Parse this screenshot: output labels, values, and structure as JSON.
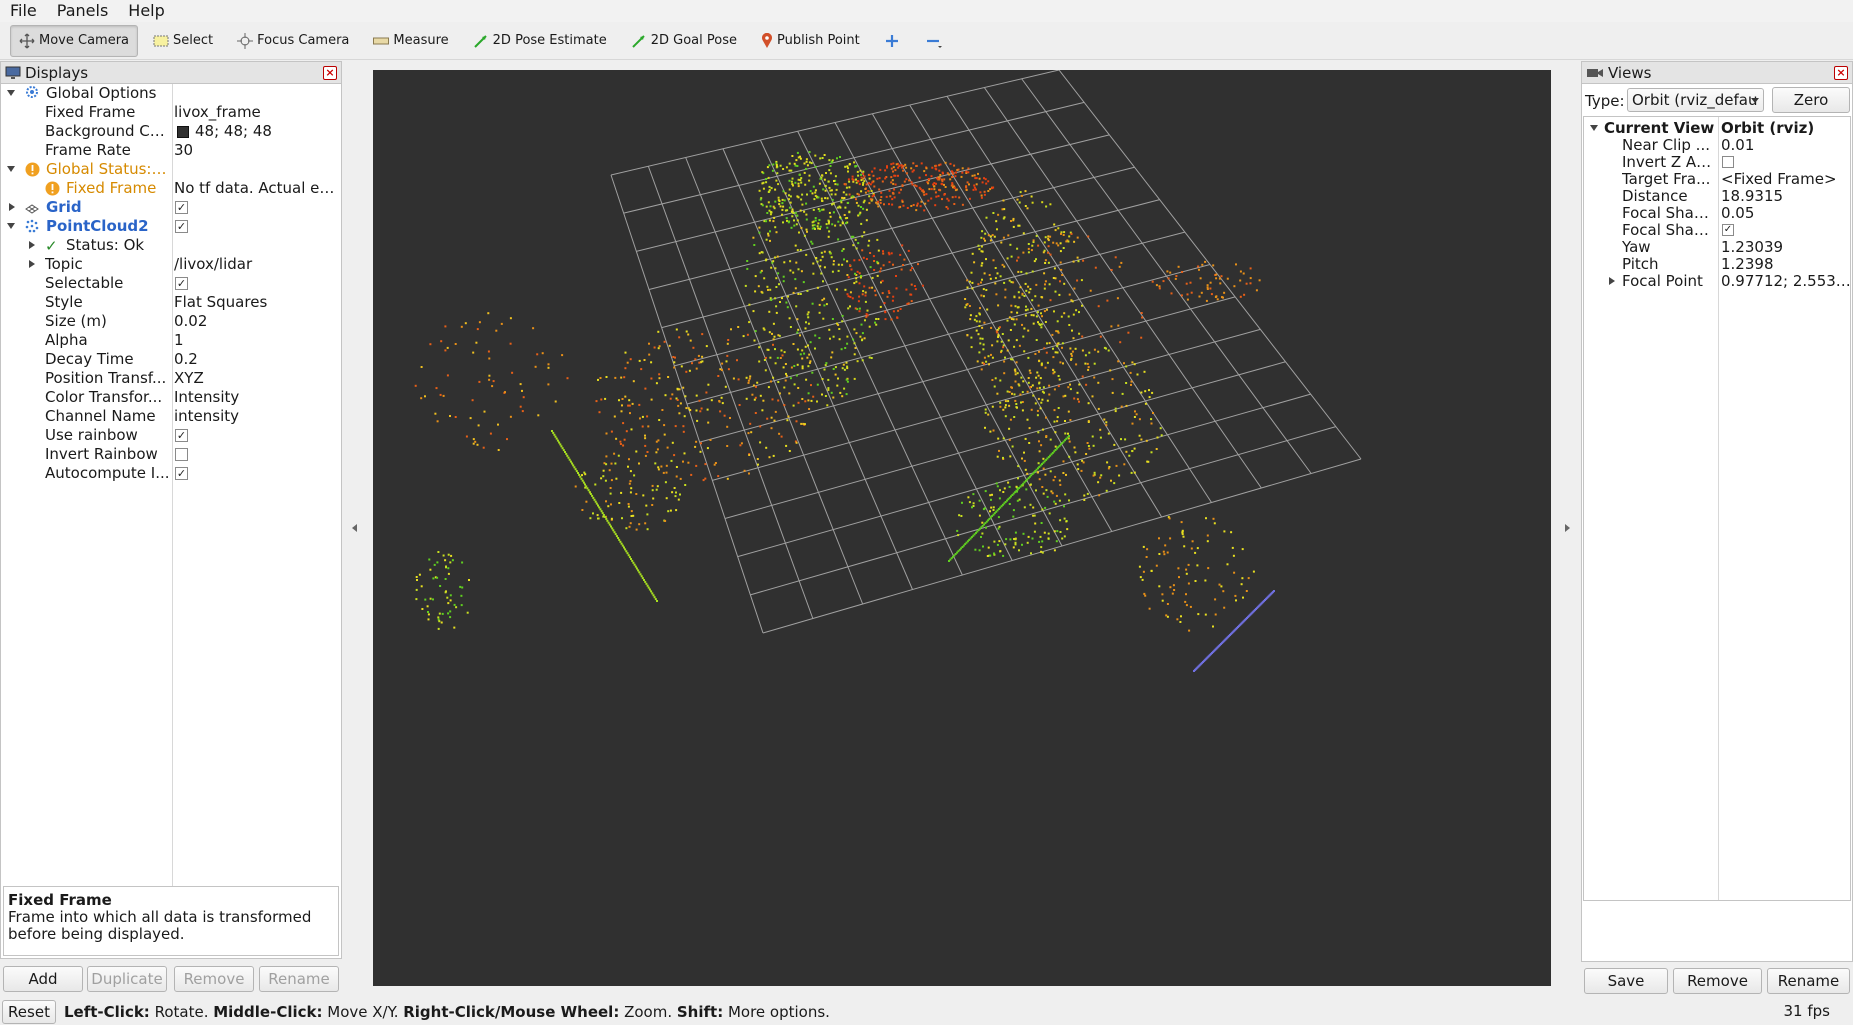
{
  "menu": [
    "File",
    "Panels",
    "Help"
  ],
  "toolbar": {
    "move_camera": "Move Camera",
    "select": "Select",
    "focus_camera": "Focus Camera",
    "measure": "Measure",
    "pose_estimate": "2D Pose Estimate",
    "goal_pose": "2D Goal Pose",
    "publish_point": "Publish Point"
  },
  "displays": {
    "title": "Displays",
    "rows": {
      "global_options": "Global Options",
      "fixed_frame_label": "Fixed Frame",
      "fixed_frame_value": "livox_frame",
      "bg_color_label": "Background Color",
      "bg_color_value": "48; 48; 48",
      "frame_rate_label": "Frame Rate",
      "frame_rate_value": "30",
      "global_status": "Global Status: ...",
      "status_fixed_frame": "Fixed Frame",
      "status_fixed_frame_value": "No tf data.  Actual err...",
      "grid": "Grid",
      "pointcloud": "PointCloud2",
      "status_ok": "Status: Ok",
      "topic_label": "Topic",
      "topic_value": "/livox/lidar",
      "selectable": "Selectable",
      "style_label": "Style",
      "style_value": "Flat Squares",
      "size_label": "Size (m)",
      "size_value": "0.02",
      "alpha_label": "Alpha",
      "alpha_value": "1",
      "decay_label": "Decay Time",
      "decay_value": "0.2",
      "pos_tf_label": "Position Transf...",
      "pos_tf_value": "XYZ",
      "color_tf_label": "Color Transfor...",
      "color_tf_value": "Intensity",
      "channel_label": "Channel Name",
      "channel_value": "intensity",
      "use_rainbow": "Use rainbow",
      "invert_rainbow": "Invert Rainbow",
      "autocompute": "Autocompute I..."
    },
    "help_title": "Fixed Frame",
    "help_text": "Frame into which all data is transformed before being displayed.",
    "buttons": {
      "add": "Add",
      "duplicate": "Duplicate",
      "remove": "Remove",
      "rename": "Rename"
    }
  },
  "views": {
    "title": "Views",
    "type_label": "Type:",
    "type_value": "Orbit (rviz_defau",
    "zero": "Zero",
    "current_view": "Current View",
    "current_view_value": "Orbit (rviz)",
    "rows": {
      "near_clip": "Near Clip ...",
      "near_clip_value": "0.01",
      "invert_z": "Invert Z Axis",
      "target_frame": "Target Fra...",
      "target_frame_value": "<Fixed Frame>",
      "distance": "Distance",
      "distance_value": "18.9315",
      "focal_shape1": "Focal Shap...",
      "focal_shape1_value": "0.05",
      "focal_shape2": "Focal Shap...",
      "yaw": "Yaw",
      "yaw_value": "1.23039",
      "pitch": "Pitch",
      "pitch_value": "1.2398",
      "focal_point": "Focal Point",
      "focal_point_value": "0.97712; 2.5538;..."
    },
    "buttons": {
      "save": "Save",
      "remove": "Remove",
      "rename": "Rename"
    }
  },
  "status": {
    "reset": "Reset",
    "left_click": "Left-Click:",
    "left_click_text": " Rotate. ",
    "middle_click": "Middle-Click:",
    "middle_click_text": " Move X/Y. ",
    "right_click": "Right-Click/Mouse Wheel:",
    "right_click_text": " Zoom. ",
    "shift": "Shift:",
    "shift_text": " More options.",
    "fps": "31 fps"
  },
  "colors": {
    "viewport_bg": "#303030",
    "grid": "#a0a0a0",
    "accent_orange": "#d68a00",
    "accent_blue": "#2a64c8"
  },
  "icons": [
    "monitor-icon",
    "gear-icon",
    "warning-icon",
    "grid-icon",
    "pointcloud-icon",
    "checkmark-icon",
    "camera-icon",
    "plus-icon",
    "minus-icon",
    "pin-icon"
  ]
}
